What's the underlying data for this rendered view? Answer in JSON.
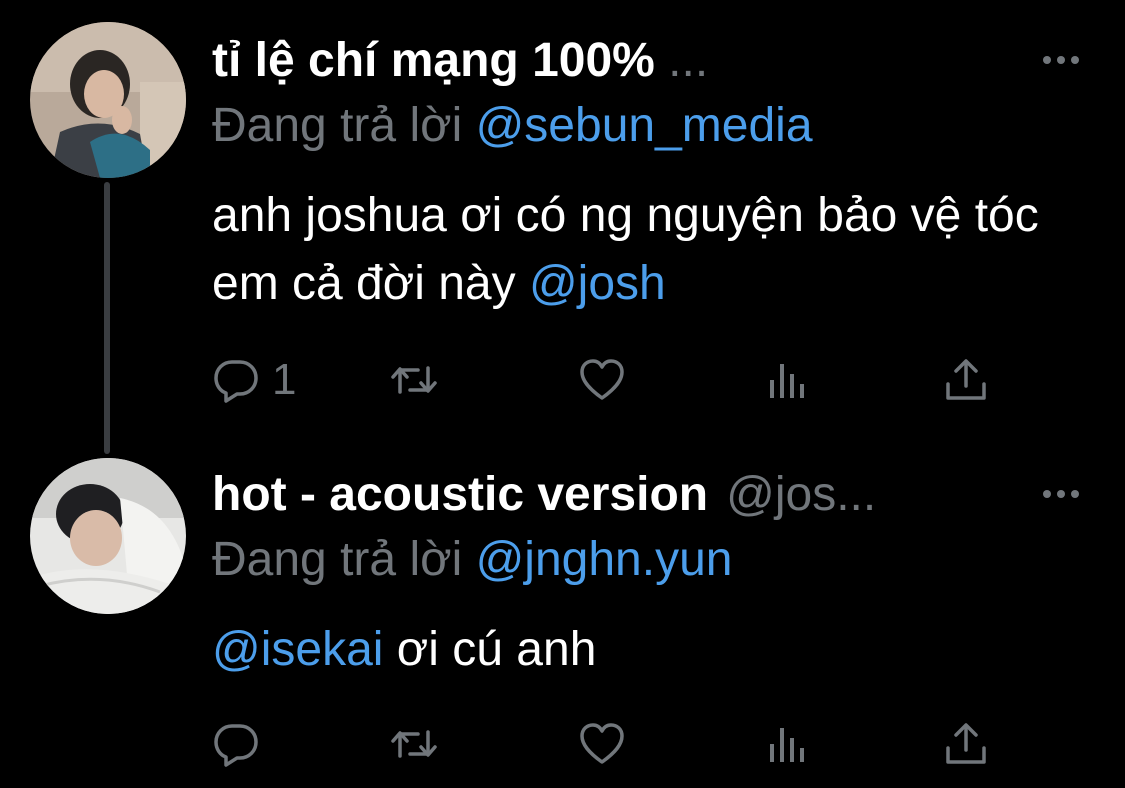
{
  "tweets": [
    {
      "display_name": "tỉ lệ chí mạng 100%",
      "display_name_more": " ...",
      "handle": "",
      "reply_prefix": "Đang trả lời ",
      "reply_to": "@sebun_media",
      "text_plain_1": "anh joshua ơi có ng nguyện bảo vệ tóc em cả đời này ",
      "text_mention_end": "@josh",
      "reply_count": "1"
    },
    {
      "display_name": "hot - acoustic version",
      "display_name_more": "",
      "handle": "@jos...",
      "reply_prefix": "Đang trả lời ",
      "reply_to": "@jnghn.yun",
      "text_mention_start": "@isekai",
      "text_plain_1": " ơi cú anh",
      "reply_count": ""
    }
  ],
  "icons": {
    "reply": "reply-icon",
    "retweet": "retweet-icon",
    "like": "heart-icon",
    "views": "views-icon",
    "share": "share-icon",
    "more": "more-icon"
  },
  "colors": {
    "background": "#000000",
    "text_primary": "#ffffff",
    "text_secondary": "#71767b",
    "mention": "#4c9eeb",
    "thread_line": "#3a3d41"
  }
}
